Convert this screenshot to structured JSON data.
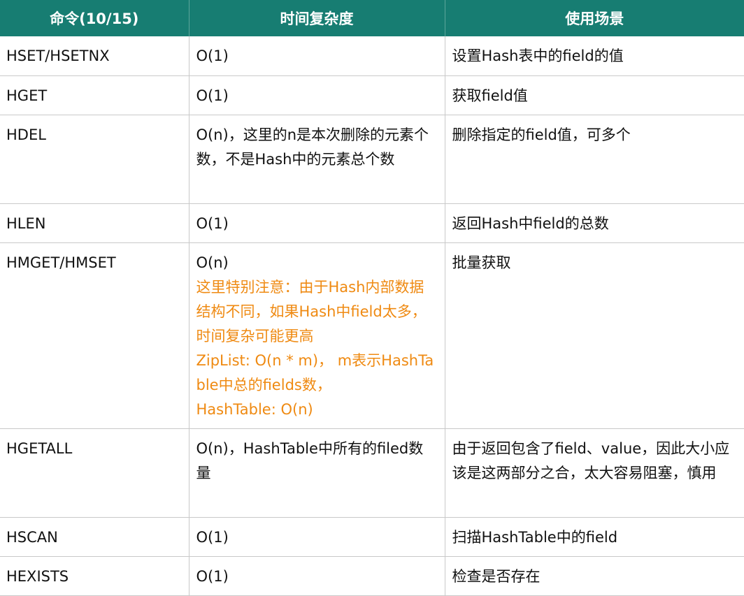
{
  "headers": [
    "命令(10/15)",
    "时间复杂度",
    "使用场景"
  ],
  "rows": [
    {
      "command": "HSET/HSETNX",
      "complexity": "O(1)",
      "note": "",
      "usage": "设置Hash表中的field的值"
    },
    {
      "command": "HGET",
      "complexity": "O(1)",
      "note": "",
      "usage": "获取field值"
    },
    {
      "command": "HDEL",
      "complexity": "O(n)，这里的n是本次删除的元素个数，不是Hash中的元素总个数",
      "note": "",
      "usage": "删除指定的field值，可多个"
    },
    {
      "command": "HLEN",
      "complexity": "O(1)",
      "note": "",
      "usage": "返回Hash中field的总数"
    },
    {
      "command": "HMGET/HMSET",
      "complexity": "O(n)",
      "note": "这里特别注意：由于Hash内部数据结构不同，如果Hash中field太多，时间复杂可能更高\nZipList: O(n * m)， m表示HashTable中总的fields数，\nHashTable: O(n)",
      "usage": "批量获取"
    },
    {
      "command": "HGETALL",
      "complexity": "O(n)，HashTable中所有的filed数量",
      "note": "",
      "usage": "由于返回包含了field、value，因此大小应该是这两部分之合，太大容易阻塞，慎用"
    },
    {
      "command": "HSCAN",
      "complexity": "O(1)",
      "note": "",
      "usage": "扫描HashTable中的field"
    },
    {
      "command": "HEXISTS",
      "complexity": "O(1)",
      "note": "",
      "usage": "检查是否存在"
    }
  ],
  "colors": {
    "header_bg": "#177d72",
    "header_text": "#ffffff",
    "note_text": "#ef8a12",
    "grid": "#c9c9c9"
  }
}
